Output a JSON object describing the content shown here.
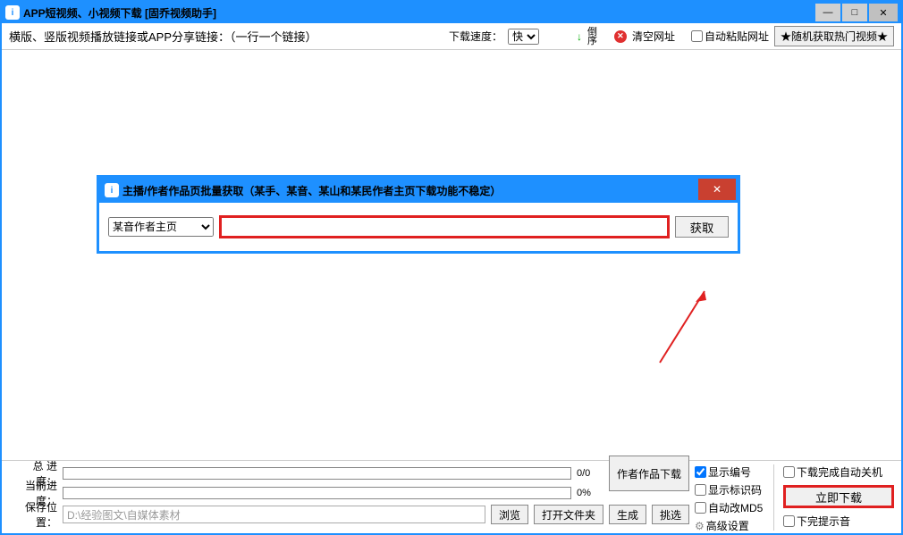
{
  "window": {
    "title": "APP短视频、小视频下载 [固乔视频助手]"
  },
  "toolbar": {
    "main_label": "横版、竖版视频播放链接或APP分享链接：（一行一个链接）",
    "speed_label": "下载速度：",
    "speed_value": "快",
    "seq_label": "倒序",
    "clear_label": "清空网址",
    "auto_paste_label": "自动粘贴网址",
    "random_btn": "★随机获取热门视频★"
  },
  "dialog": {
    "title": "主播/作者作品页批量获取（某手、某音、某山和某民作者主页下载功能不稳定）",
    "select_value": "某音作者主页",
    "input_value": "",
    "fetch_btn": "获取"
  },
  "progress": {
    "total_label": "总 进 度：",
    "total_value": "0/0",
    "current_label": "当前进度：",
    "current_value": "0%",
    "save_label": "保存位置：",
    "save_path": "D:\\经验图文\\自媒体素材"
  },
  "buttons": {
    "browse": "浏览",
    "open_folder": "打开文件夹",
    "generate": "生成",
    "pick": "挑选",
    "author_download": "作者作品下载",
    "download_now": "立即下载"
  },
  "options": {
    "show_number": "显示编号",
    "show_marker": "显示标识码",
    "auto_md5": "自动改MD5",
    "advanced": "高级设置",
    "shutdown_after": "下载完成自动关机",
    "sound_after": "下完提示音"
  }
}
